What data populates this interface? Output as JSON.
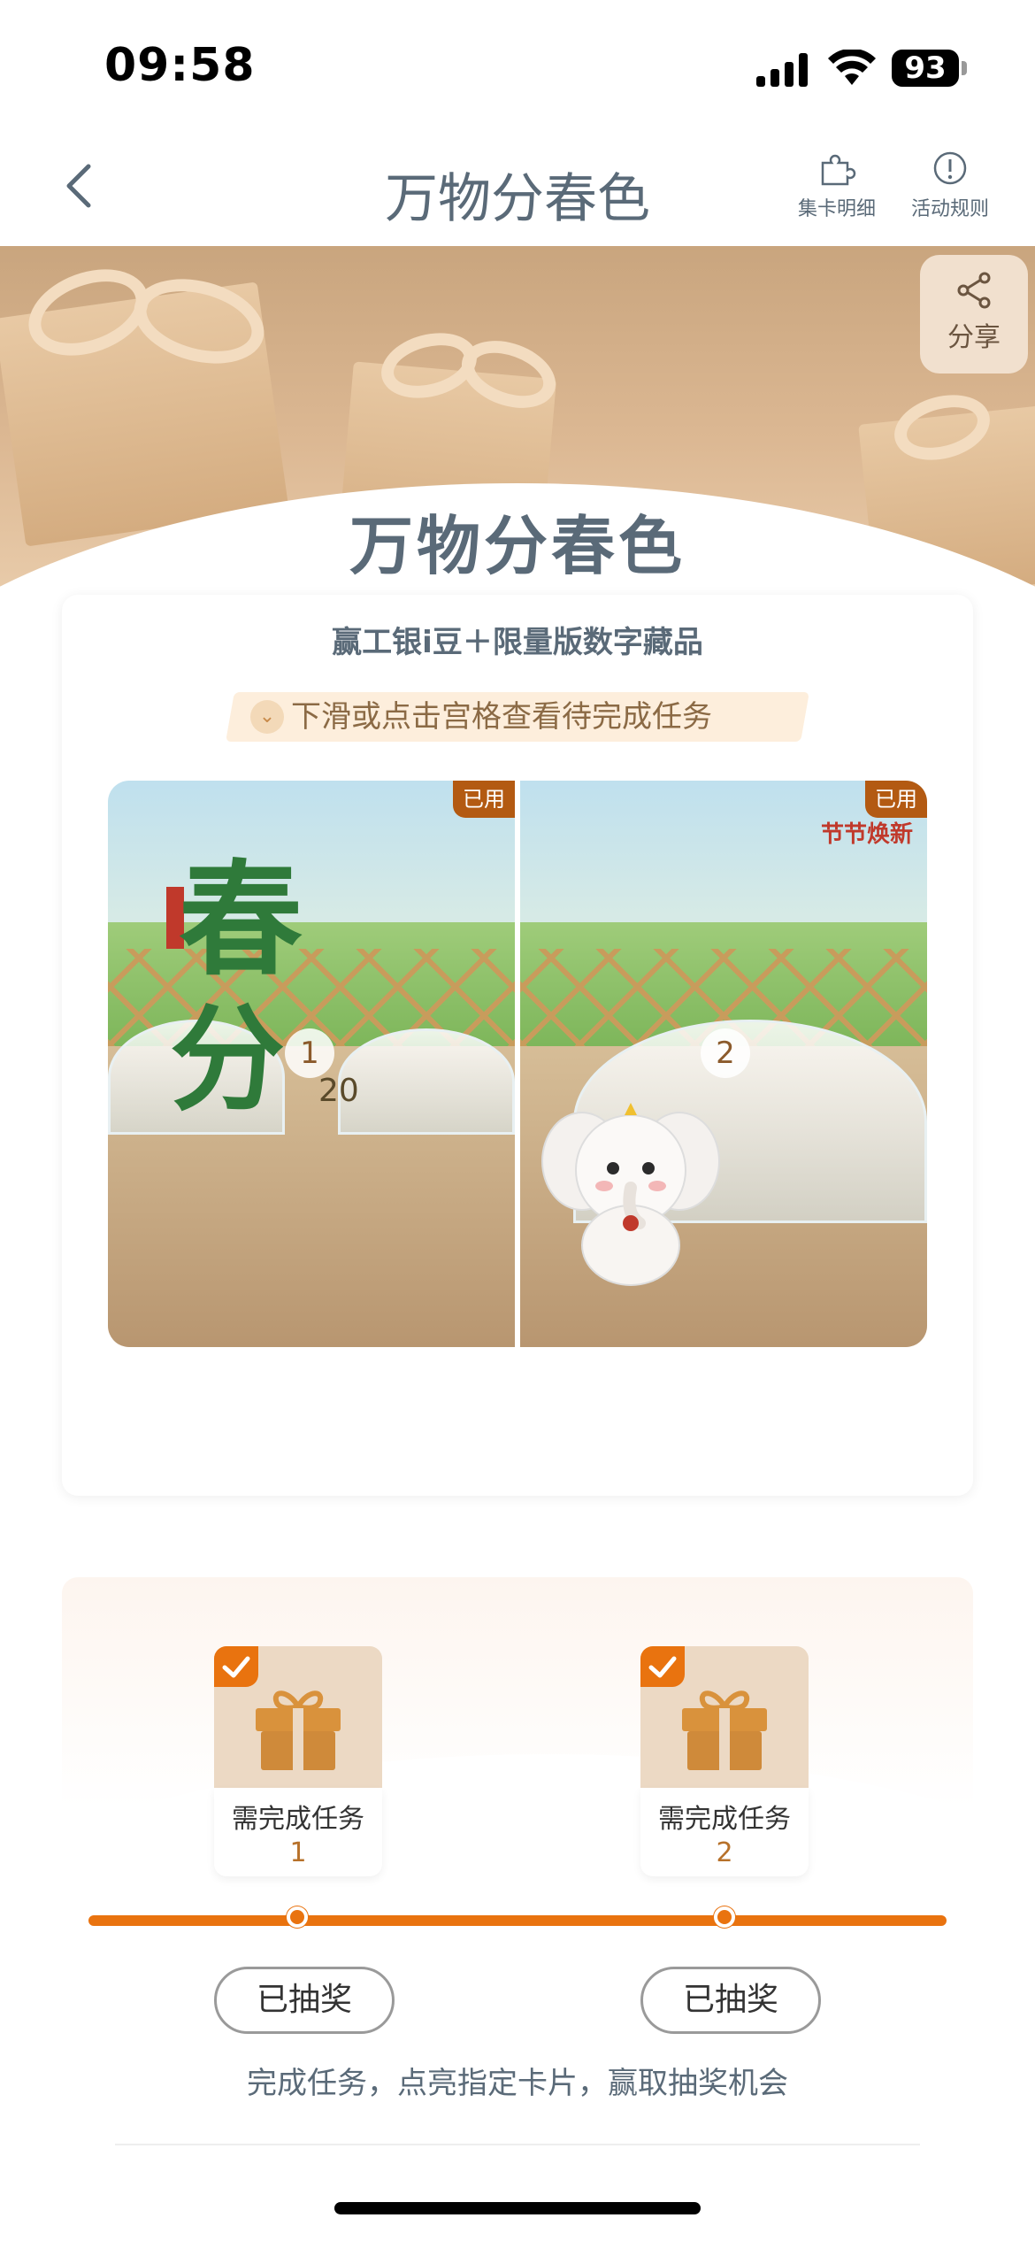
{
  "status_bar": {
    "time": "09:58",
    "battery": "93"
  },
  "nav": {
    "title": "万物分春色",
    "card_detail_label": "集卡明细",
    "rules_label": "活动规则"
  },
  "banner": {
    "share_label": "分享",
    "title": "万物分春色"
  },
  "collection": {
    "subtitle": "赢工银i豆＋限量版数字藏品",
    "tip": "下滑或点击宫格查看待完成任务",
    "pieces": [
      {
        "number": "1",
        "tag": "已用",
        "chun": "春",
        "fen": "分",
        "fraction": "20"
      },
      {
        "number": "2",
        "tag": "已用",
        "slogan": "节节焕新"
      }
    ]
  },
  "tasks": {
    "rewards": [
      {
        "label": "需完成任务",
        "count": "1",
        "button": "已抽奖"
      },
      {
        "label": "需完成任务",
        "count": "2",
        "button": "已抽奖"
      }
    ],
    "progress": 1.0,
    "footer": "完成任务，点亮指定卡片，赢取抽奖机会"
  },
  "colors": {
    "accent": "#e9730f",
    "title": "#5a6a78",
    "tag": "#b35a12"
  }
}
